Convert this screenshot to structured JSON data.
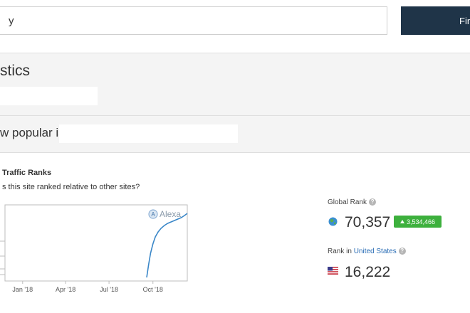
{
  "search": {
    "value": "y"
  },
  "toolbar": {
    "find_label": "Fin"
  },
  "header": {
    "title": "stics",
    "subtitle": "w popular is"
  },
  "traffic": {
    "section_title": "Traffic Ranks",
    "question": "s this site ranked relative to other sites?",
    "global_rank_label": "Global Rank",
    "global_rank_value": "70,357",
    "global_rank_delta": "3,534,466",
    "country_rank_prefix": "Rank in",
    "country_name": "United States",
    "country_rank_value": "16,222",
    "delta_color": "#3db03d"
  },
  "chart_data": {
    "type": "line",
    "watermark": "Alexa",
    "x_tick_labels": [
      "Jan '18",
      "Apr '18",
      "Jul '18",
      "Oct '18"
    ],
    "series": [
      {
        "color": "#3a87c8",
        "x": [
          "2018-09-18",
          "2018-09-22",
          "2018-09-26",
          "2018-10-01",
          "2018-10-06",
          "2018-10-12",
          "2018-10-18",
          "2018-10-25",
          "2018-11-01",
          "2018-11-08",
          "2018-11-15",
          "2018-11-22",
          "2018-11-29",
          "2018-12-06",
          "2018-12-12"
        ],
        "y": [
          1.0,
          0.82,
          0.66,
          0.53,
          0.43,
          0.36,
          0.31,
          0.27,
          0.24,
          0.22,
          0.2,
          0.18,
          0.16,
          0.13,
          0.1
        ]
      }
    ]
  }
}
